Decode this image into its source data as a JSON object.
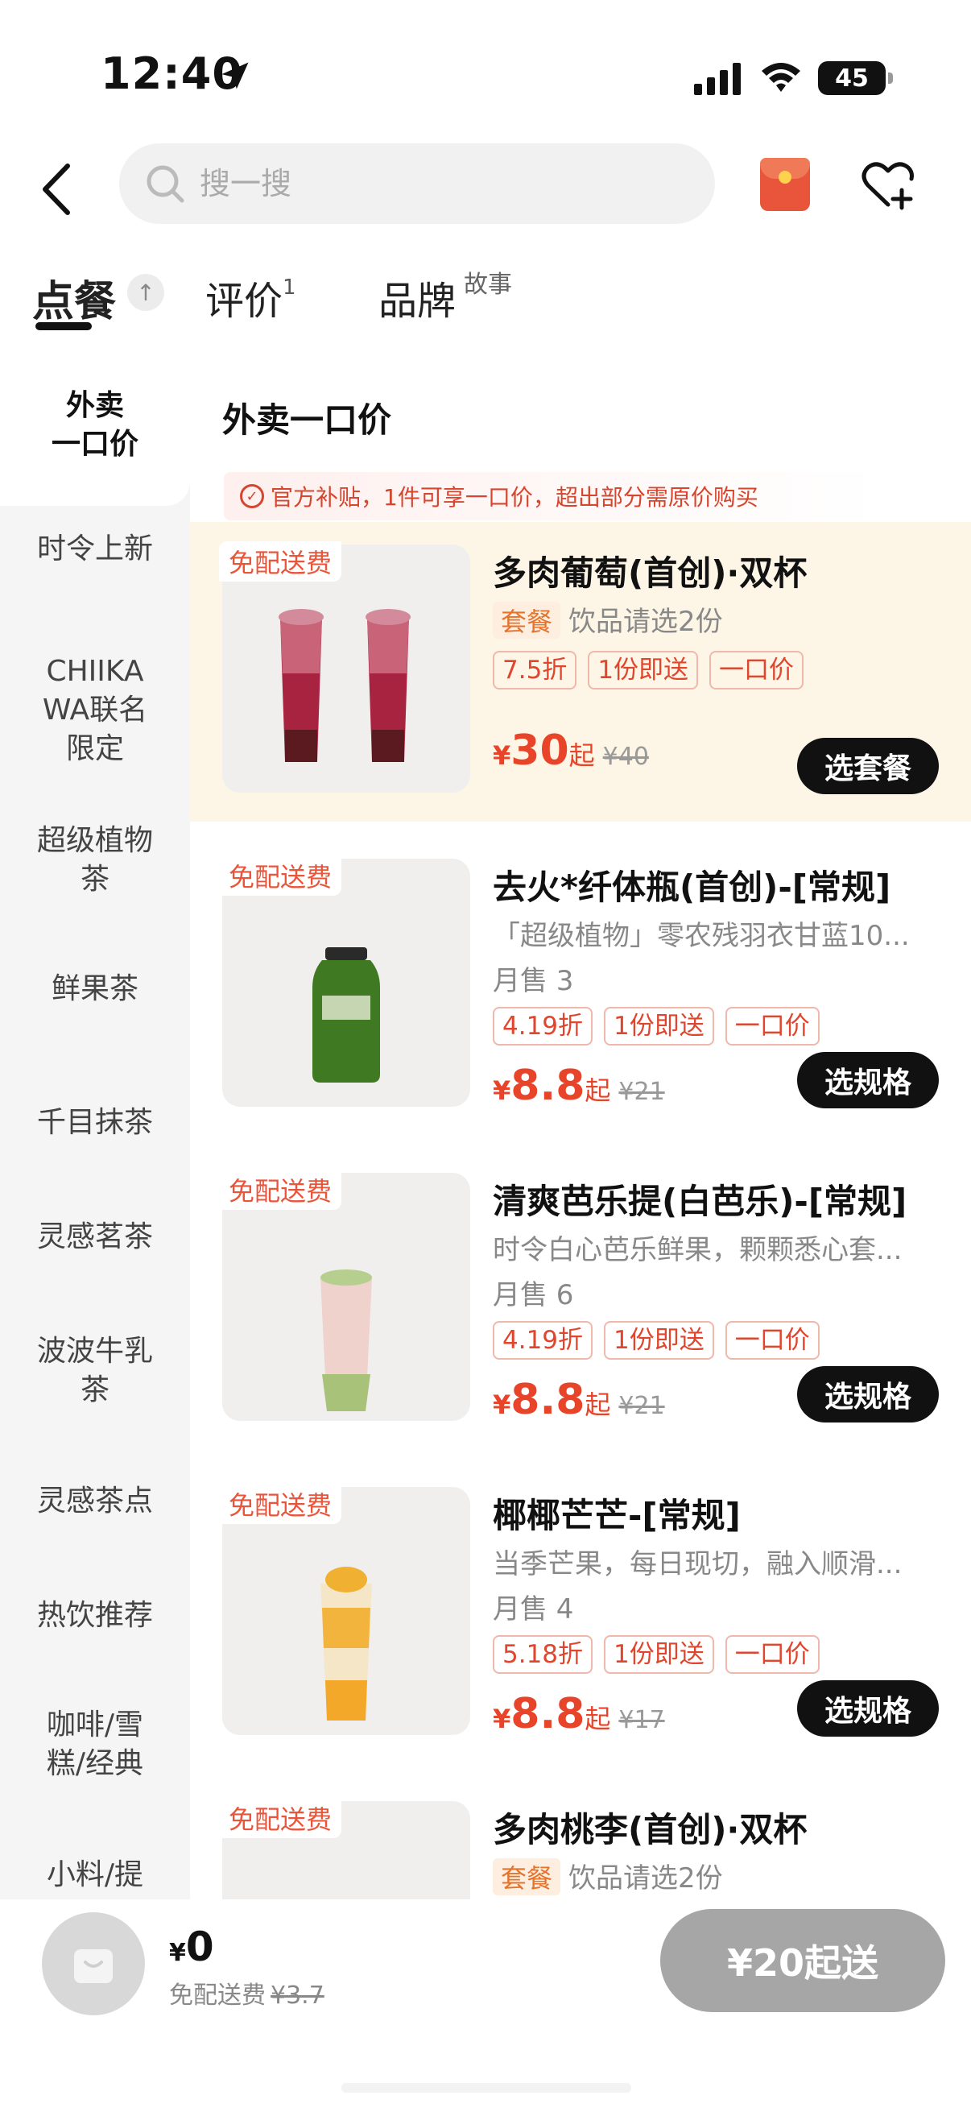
{
  "status_bar": {
    "time": "12:40",
    "battery": "45"
  },
  "header": {
    "search_placeholder": "搜一搜"
  },
  "tabs": {
    "order": "点餐",
    "reviews": "评价",
    "reviews_count": "1",
    "brand": "品牌",
    "brand_sup": "故事",
    "to_top": "↑"
  },
  "sidebar": {
    "active": "外卖\n一口价",
    "items": [
      "时令上新",
      "CHIIKA\nWA联名\n限定",
      "超级植物\n茶",
      "鲜果茶",
      "千目抹茶",
      "灵感茗茶",
      "波波牛乳\n茶",
      "灵感茶点",
      "热饮推荐",
      "咖啡/雪\n糕/经典",
      "小料/提"
    ]
  },
  "section": {
    "title": "外卖一口价",
    "notice": "官方补贴，1件可享一口价，超出部分需原价购买"
  },
  "products": [
    {
      "badge": "免配送费",
      "name": "多肉葡萄(首创)·双杯",
      "set_tag": "套餐",
      "desc": "饮品请选2份",
      "sales": "",
      "tags": [
        "7.5折",
        "1份即送",
        "一口价"
      ],
      "currency": "¥",
      "price": "30",
      "suffix": "起",
      "old_price": "¥40",
      "button": "选套餐"
    },
    {
      "badge": "免配送费",
      "name": "去火*纤体瓶(首创)-[常规]",
      "desc": "「超级植物」零农残羽衣甘蓝10...",
      "sales": "月售 3",
      "tags": [
        "4.19折",
        "1份即送",
        "一口价"
      ],
      "currency": "¥",
      "price": "8.8",
      "suffix": "起",
      "old_price": "¥21",
      "button": "选规格"
    },
    {
      "badge": "免配送费",
      "name": "清爽芭乐提(白芭乐)-[常规]",
      "desc": "时令白心芭乐鲜果，颗颗悉心套...",
      "sales": "月售 6",
      "tags": [
        "4.19折",
        "1份即送",
        "一口价"
      ],
      "currency": "¥",
      "price": "8.8",
      "suffix": "起",
      "old_price": "¥21",
      "button": "选规格"
    },
    {
      "badge": "免配送费",
      "name": "椰椰芒芒-[常规]",
      "desc": "当季芒果，每日现切，融入顺滑...",
      "sales": "月售 4",
      "tags": [
        "5.18折",
        "1份即送",
        "一口价"
      ],
      "currency": "¥",
      "price": "8.8",
      "suffix": "起",
      "old_price": "¥17",
      "button": "选规格"
    },
    {
      "badge": "免配送费",
      "name": "多肉桃李(首创)·双杯",
      "set_tag": "套餐",
      "desc": "饮品请选2份"
    }
  ],
  "bottom": {
    "currency": "¥",
    "total": "0",
    "fee_label": "免配送费",
    "fee_old": "¥3.7",
    "checkout": "¥20起送"
  },
  "colors": {
    "accent": "#e8442a",
    "button": "#111111",
    "highlight": "#fdf6e6"
  }
}
